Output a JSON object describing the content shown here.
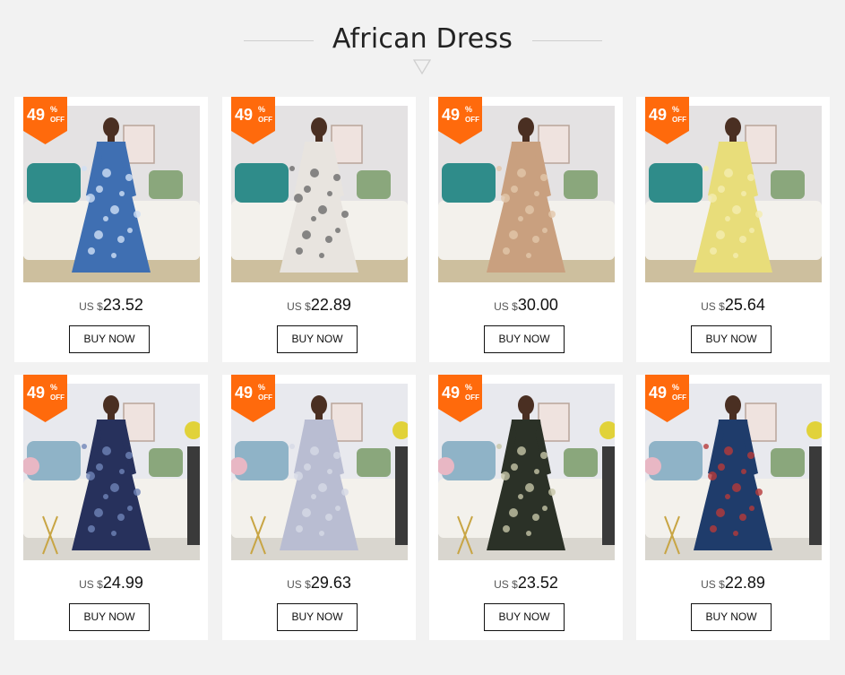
{
  "section": {
    "title": "African Dress"
  },
  "products": [
    {
      "discount": "49",
      "percent": "%",
      "off": "OFF",
      "currency": "US $",
      "price": "23.52",
      "button": "BUY NOW",
      "dress_color": "#3f6fb2",
      "dress_accent": "#cfe0f5"
    },
    {
      "discount": "49",
      "percent": "%",
      "off": "OFF",
      "currency": "US $",
      "price": "22.89",
      "button": "BUY NOW",
      "dress_color": "#e8e4df",
      "dress_accent": "#6b6b6b"
    },
    {
      "discount": "49",
      "percent": "%",
      "off": "OFF",
      "currency": "US $",
      "price": "30.00",
      "button": "BUY NOW",
      "dress_color": "#c9a07f",
      "dress_accent": "#e2c7aa"
    },
    {
      "discount": "49",
      "percent": "%",
      "off": "OFF",
      "currency": "US $",
      "price": "25.64",
      "button": "BUY NOW",
      "dress_color": "#e8dd7a",
      "dress_accent": "#f4eeb0"
    },
    {
      "discount": "49",
      "percent": "%",
      "off": "OFF",
      "currency": "US $",
      "price": "24.99",
      "button": "BUY NOW",
      "dress_color": "#27315c",
      "dress_accent": "#6f84b8"
    },
    {
      "discount": "49",
      "percent": "%",
      "off": "OFF",
      "currency": "US $",
      "price": "29.63",
      "button": "BUY NOW",
      "dress_color": "#b9bdd2",
      "dress_accent": "#d6d9e6"
    },
    {
      "discount": "49",
      "percent": "%",
      "off": "OFF",
      "currency": "US $",
      "price": "23.52",
      "button": "BUY NOW",
      "dress_color": "#2b3127",
      "dress_accent": "#c5c6a8"
    },
    {
      "discount": "49",
      "percent": "%",
      "off": "OFF",
      "currency": "US $",
      "price": "22.89",
      "button": "BUY NOW",
      "dress_color": "#1f3c6b",
      "dress_accent": "#b53a3a"
    }
  ],
  "colors": {
    "badge": "#ff6a0c",
    "background": "#f2f2f2"
  },
  "icons": {
    "title_marker": "down-triangle-icon"
  }
}
